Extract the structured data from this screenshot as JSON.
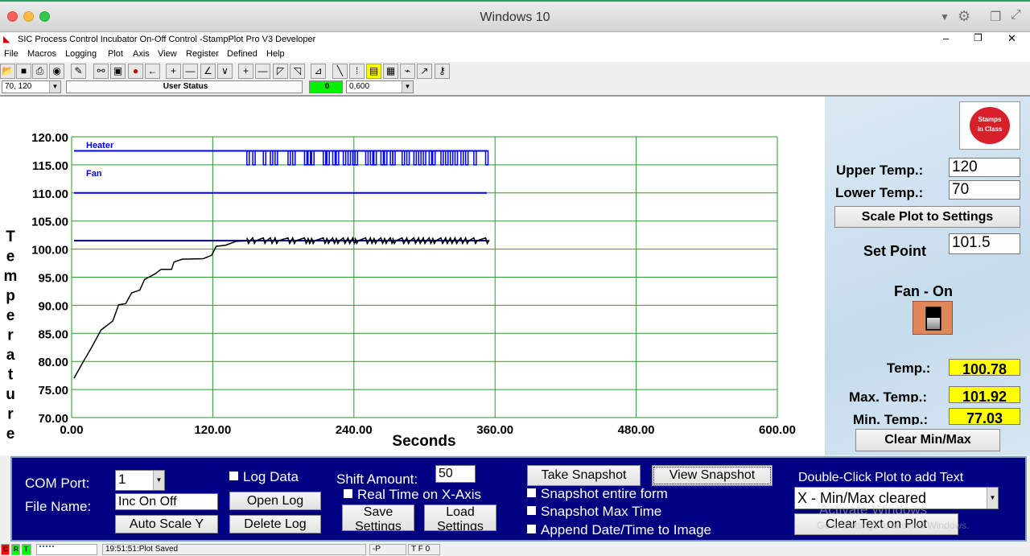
{
  "os": {
    "title": "Windows 10"
  },
  "app": {
    "title": "SIC Process Control Incubator On-Off Control -StampPlot Pro V3 Developer"
  },
  "menu": [
    "File",
    "Macros",
    "Logging",
    "Plot",
    "Axis",
    "View",
    "Register",
    "Defined",
    "Help"
  ],
  "toolbar_icons": [
    "open-icon",
    "save-icon",
    "print-icon",
    "camera-icon",
    "wand-icon",
    "connect-icon",
    "monitor-icon",
    "stop-icon",
    "arrow-left-icon",
    "plus-icon",
    "minus-icon",
    "zoom-x-in-icon",
    "zoom-x-out-icon",
    "plus-icon",
    "minus-icon",
    "zoom-y-in-icon",
    "zoom-y-out-icon",
    "axis-icon",
    "pen-icon",
    "points-icon",
    "note-icon",
    "calc-icon",
    "plug-icon",
    "chart-icon",
    "key-icon"
  ],
  "combos": {
    "y_range": "70, 120",
    "user_status": "User Status",
    "counter": "0",
    "x_range": "0,600"
  },
  "chart_data": {
    "type": "line",
    "xlabel": "Seconds",
    "ylabel": "Temperature",
    "xlim": [
      0,
      600
    ],
    "ylim": [
      70,
      120
    ],
    "xticks": [
      "0.00",
      "120.00",
      "240.00",
      "360.00",
      "480.00",
      "600.00"
    ],
    "yticks": [
      "70.00",
      "75.00",
      "80.00",
      "85.00",
      "90.00",
      "95.00",
      "100.00",
      "105.00",
      "110.00",
      "115.00",
      "120.00"
    ],
    "grid": true,
    "grid_color": "#2a9a2a",
    "temperature": {
      "color": "#000000",
      "x": [
        2,
        10,
        17,
        25,
        35,
        40,
        46,
        51,
        58,
        62,
        71,
        76,
        85,
        87,
        94,
        112,
        119,
        123,
        131,
        140,
        150
      ],
      "y": [
        77.0,
        80.0,
        82.5,
        85.6,
        87.2,
        90.1,
        90.3,
        92.2,
        92.7,
        94.6,
        95.6,
        96.4,
        96.4,
        97.7,
        98.2,
        98.3,
        98.9,
        100.5,
        100.7,
        101.4,
        101.5
      ],
      "oscillation_end": 353,
      "oscillation_band": [
        101.0,
        102.0
      ]
    },
    "setpoint": {
      "color": "#000080",
      "value": 101.5,
      "x": [
        0,
        353
      ]
    },
    "heater": {
      "name": "Heater",
      "color": "#0000ff",
      "high": 117.5,
      "low": 115.0,
      "x": [
        0,
        353
      ],
      "off_pulses": [
        149,
        154,
        163,
        169,
        173,
        184,
        188,
        198,
        201,
        204,
        214,
        217,
        222,
        225,
        231,
        235,
        239,
        241,
        250,
        254,
        257,
        263,
        266,
        271,
        273,
        281,
        285,
        291,
        295,
        299,
        304,
        307,
        314,
        318,
        322,
        326,
        331,
        335,
        342,
        352
      ]
    },
    "fan": {
      "name": "Fan",
      "color": "#0000ff",
      "value": 110.0,
      "x": [
        0,
        353
      ]
    }
  },
  "side": {
    "logo": "Stamps in Class",
    "upper_label": "Upper Temp.:",
    "upper_value": "120",
    "lower_label": "Lower Temp.:",
    "lower_value": "70",
    "scale_button": "Scale Plot to Settings",
    "setpoint_label": "Set Point",
    "setpoint_value": "101.5",
    "fan_label": "Fan - On",
    "temp_label": "Temp.:",
    "temp_value": "100.78",
    "max_label": "Max. Temp.:",
    "max_value": "101.92",
    "min_label": "Min. Temp.:",
    "min_value": "77.03",
    "clear_button": "Clear Min/Max"
  },
  "bottom": {
    "com_label": "COM Port:",
    "com_value": "1",
    "file_label": "File Name:",
    "file_value": "Inc  On  Off",
    "autoscale": "Auto Scale Y",
    "log_data": "Log Data",
    "open_log": "Open Log",
    "delete_log": "Delete Log",
    "shift_label": "Shift Amount:",
    "shift_value": "50",
    "realtime": "Real Time on X-Axis",
    "save_settings": "Save Settings",
    "load_settings": "Load Settings",
    "take_snapshot": "Take Snapshot",
    "view_snapshot": "View Snapshot",
    "snap_entire": "Snapshot entire form",
    "snap_max": "Snapshot Max Time",
    "append_date": "Append Date/Time to Image",
    "text_label": "Double-Click Plot to add Text",
    "text_value": "X - Min/Max cleared",
    "clear_text": "Clear Text on Plot",
    "watermark1": "Activate Windows",
    "watermark2": "Go to Settings to activate Windows."
  },
  "status": {
    "c": "C",
    "r": "R",
    "t": "T",
    "message": "19:51:51:Plot Saved",
    "p": "-P",
    "tf": "T F 0"
  }
}
